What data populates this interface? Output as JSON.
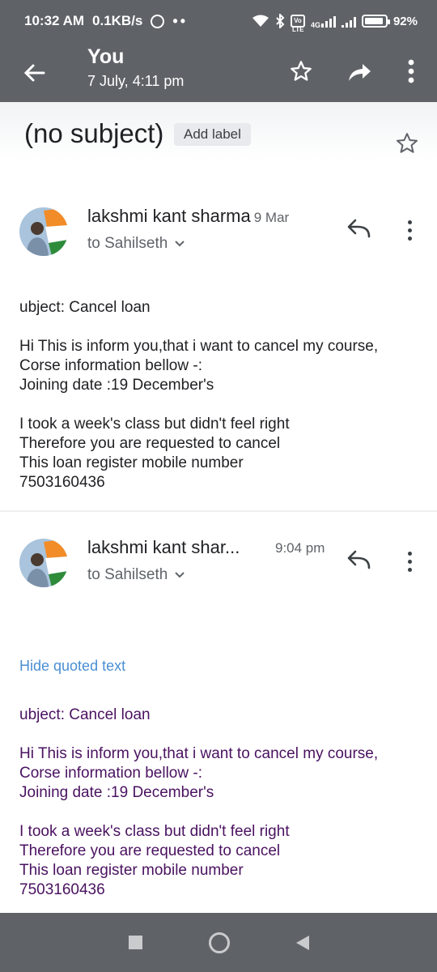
{
  "status_bar": {
    "time": "10:32 AM",
    "speed": "0.1KB/s",
    "dots": "••",
    "network_badge": "Vo LTE",
    "network_type": "4G",
    "battery": "92%",
    "battery_level": 0.92
  },
  "app_bar": {
    "title": "You",
    "subtitle": "7 July, 4:11 pm"
  },
  "thread": {
    "subject": "(no subject)",
    "add_label": "Add label"
  },
  "messages": [
    {
      "sender": "lakshmi kant sharma",
      "date": "9 Mar",
      "to": "to Sahilseth",
      "body": {
        "line1": "ubject: Cancel loan",
        "para2": "Hi This is inform you,that i want to cancel my course,\nCorse information bellow -:\nJoining date :19 December's",
        "para3": "I took a week's class but didn't feel right\nTherefore you are requested to cancel\nThis loan register mobile number\n7503160436"
      }
    },
    {
      "sender": "lakshmi kant shar...",
      "date": "9:04 pm",
      "to": "to Sahilseth",
      "hide_quoted": "Hide quoted text",
      "body": {
        "line1": "ubject: Cancel loan",
        "para2": "Hi This is inform you,that i want to cancel my course,\nCorse information bellow -:\nJoining date :19 December's",
        "para3": "I took a week's class but didn't feel right\nTherefore you are requested to cancel\nThis loan register mobile number\n7503160436"
      }
    }
  ],
  "colors": {
    "app_bar": "#5f6368",
    "link": "#4a8fd3",
    "quoted_text": "#4a1260"
  }
}
